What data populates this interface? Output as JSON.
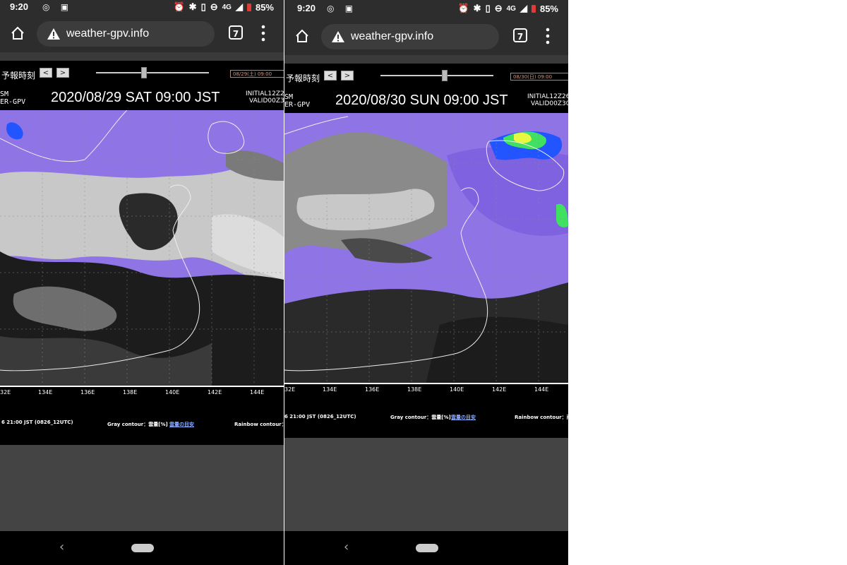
{
  "screens": [
    {
      "status": {
        "time": "9:20",
        "signal": "4G",
        "battery": "85%"
      },
      "browser": {
        "url": "weather-gpv.info",
        "tab_count": "7"
      },
      "controls": {
        "label": "予報時刻",
        "prev": "<",
        "next": ">",
        "select_value": "08/29(土) 09:00",
        "slider_level": 0.45
      },
      "header": {
        "model_line1": "SM",
        "model_line2": "ER-GPV",
        "datetime": "2020/08/29  SAT  09:00  JST",
        "initial": "INITIAL12Z2",
        "valid": "VALID00Z3"
      },
      "axis_labels": [
        "32E",
        "134E",
        "136E",
        "138E",
        "140E",
        "142E",
        "144E"
      ],
      "info": {
        "init_time": "6 21:00 JST (0826_12UTC)",
        "gray_contour": "Gray contour：雲量[%]",
        "gray_link": "雲量の目安",
        "rainbow_contour": "Rainbow contour："
      }
    },
    {
      "status": {
        "time": "9:20",
        "signal": "4G",
        "battery": "85%"
      },
      "browser": {
        "url": "weather-gpv.info",
        "tab_count": "7"
      },
      "controls": {
        "label": "予報時刻",
        "prev": "<",
        "next": ">",
        "select_value": "08/30(日) 09:00",
        "slider_level": 0.58
      },
      "header": {
        "model_line1": "SM",
        "model_line2": "ER-GPV",
        "datetime": "2020/08/30  SUN  09:00  JST",
        "initial": "INITIAL12Z26",
        "valid": "VALID00Z30"
      },
      "axis_labels": [
        "32E",
        "134E",
        "136E",
        "138E",
        "140E",
        "142E",
        "144E"
      ],
      "info": {
        "init_time": "6 21:00 JST (0826_12UTC)",
        "gray_contour": "Gray contour：雲量[%]",
        "gray_link": "雲量の目安",
        "rainbow_contour": "Rainbow contour：雨"
      }
    }
  ],
  "colors": {
    "rain_purple": "#8f74e6",
    "cloud_light": "#c8c8c8",
    "cloud_mid": "#8a8a8a",
    "cloud_dark": "#1c1c1c",
    "heavy_blue": "#2255ff",
    "heavy_green": "#40e060"
  }
}
